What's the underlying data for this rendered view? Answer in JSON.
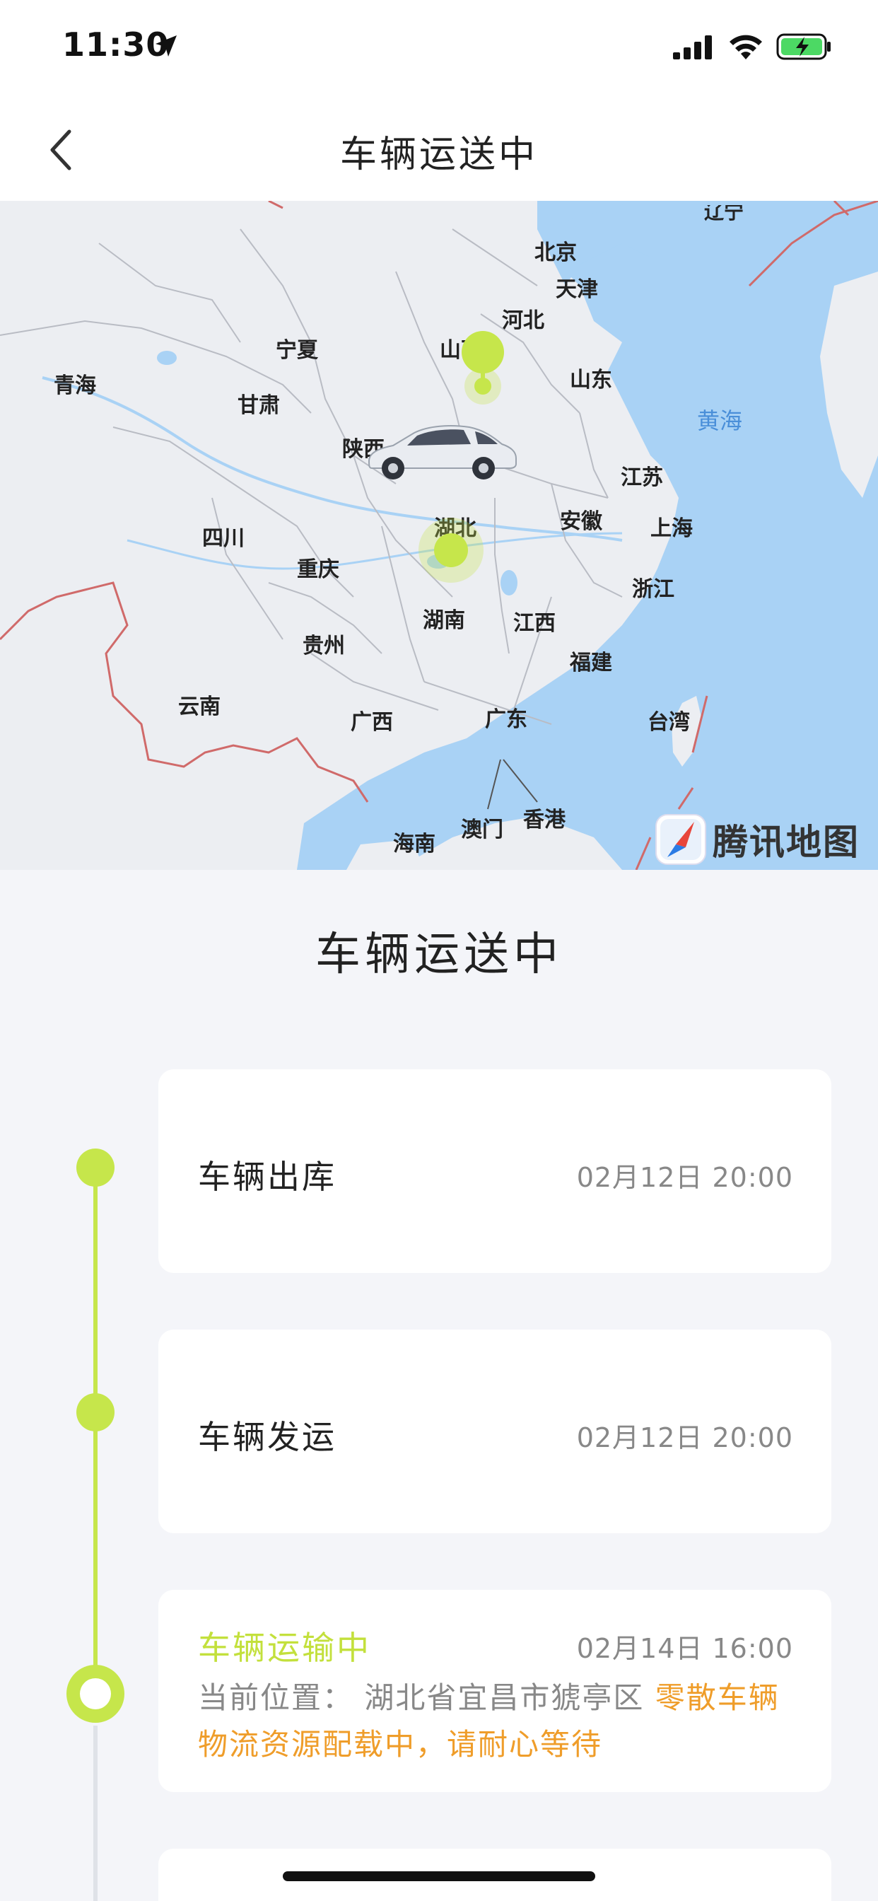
{
  "status_bar": {
    "time": "11:30"
  },
  "nav": {
    "title": "车辆运送中"
  },
  "map": {
    "labels": {
      "beijing": "北京",
      "tianjin": "天津",
      "hebei": "河北",
      "shanxi": "山西",
      "shandong": "山东",
      "ningxia": "宁夏",
      "qinghai": "青海",
      "gansu": "甘肃",
      "shaanxi": "陕西",
      "jiangsu": "江苏",
      "anhui": "安徽",
      "shanghai": "上海",
      "sichuan": "四川",
      "hubei": "湖北",
      "chongqing": "重庆",
      "zhejiang": "浙江",
      "hunan": "湖南",
      "jiangxi": "江西",
      "guizhou": "贵州",
      "fujian": "福建",
      "yunnan": "云南",
      "guangxi": "广西",
      "guangdong": "广东",
      "taiwan": "台湾",
      "aomen": "澳门",
      "xianggang": "香港",
      "hainan": "海南",
      "huanghai": "黄海",
      "liaoning_partial": "辽宁"
    },
    "logo_text": "腾讯地图"
  },
  "section_title": "车辆运送中",
  "timeline": [
    {
      "title": "车辆出库",
      "time": "02月12日 20:00"
    },
    {
      "title": "车辆发运",
      "time": "02月12日 20:00"
    },
    {
      "title": "车辆运输中",
      "time": "02月14日 16:00",
      "location_label": "当前位置：",
      "location": "湖北省宜昌市猇亭区",
      "status_note": "零散车辆物流资源配载中，请耐心等待"
    }
  ],
  "colors": {
    "accent": "#c6e64b",
    "highlight": "#ef9d2a",
    "sea": "#a9d2f5"
  }
}
